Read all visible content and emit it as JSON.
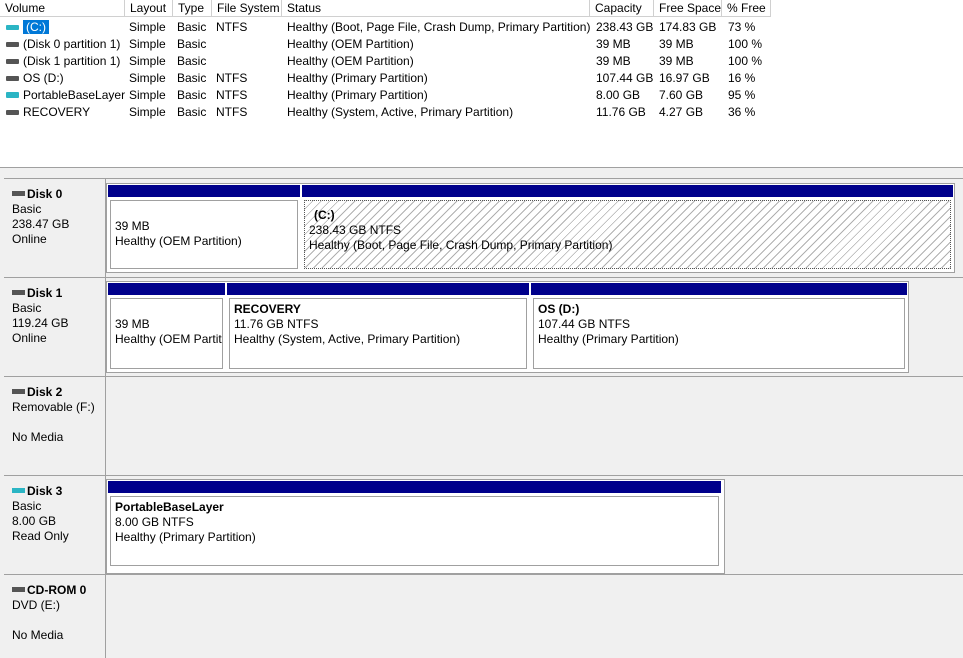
{
  "columns": [
    "Volume",
    "Layout",
    "Type",
    "File System",
    "Status",
    "Capacity",
    "Free Space",
    "% Free"
  ],
  "volumes": [
    {
      "name": "(C:)",
      "layout": "Simple",
      "type": "Basic",
      "fs": "NTFS",
      "status": "Healthy (Boot, Page File, Crash Dump, Primary Partition)",
      "capacity": "238.43 GB",
      "free": "174.83 GB",
      "pct": "73 %"
    },
    {
      "name": "(Disk 0 partition 1)",
      "layout": "Simple",
      "type": "Basic",
      "fs": "",
      "status": "Healthy (OEM Partition)",
      "capacity": "39 MB",
      "free": "39 MB",
      "pct": "100 %"
    },
    {
      "name": "(Disk 1 partition 1)",
      "layout": "Simple",
      "type": "Basic",
      "fs": "",
      "status": "Healthy (OEM Partition)",
      "capacity": "39 MB",
      "free": "39 MB",
      "pct": "100 %"
    },
    {
      "name": "OS (D:)",
      "layout": "Simple",
      "type": "Basic",
      "fs": "NTFS",
      "status": "Healthy (Primary Partition)",
      "capacity": "107.44 GB",
      "free": "16.97 GB",
      "pct": "16 %"
    },
    {
      "name": "PortableBaseLayer",
      "layout": "Simple",
      "type": "Basic",
      "fs": "NTFS",
      "status": "Healthy (Primary Partition)",
      "capacity": "8.00 GB",
      "free": "7.60 GB",
      "pct": "95 %"
    },
    {
      "name": "RECOVERY",
      "layout": "Simple",
      "type": "Basic",
      "fs": "NTFS",
      "status": "Healthy (System, Active, Primary Partition)",
      "capacity": "11.76 GB",
      "free": "4.27 GB",
      "pct": "36 %"
    }
  ],
  "disks": [
    {
      "title": "Disk 0",
      "line1": "Basic",
      "line2": "238.47 GB",
      "line3": "Online",
      "partitions": [
        {
          "name": "",
          "size": "39 MB",
          "status": "Healthy (OEM Partition)"
        },
        {
          "name": "(C:)",
          "size": "238.43 GB NTFS",
          "status": "Healthy (Boot, Page File, Crash Dump, Primary Partition)"
        }
      ]
    },
    {
      "title": "Disk 1",
      "line1": "Basic",
      "line2": "119.24 GB",
      "line3": "Online",
      "partitions": [
        {
          "name": "",
          "size": "39 MB",
          "status": "Healthy (OEM Partit"
        },
        {
          "name": "RECOVERY",
          "size": "11.76 GB NTFS",
          "status": "Healthy (System, Active, Primary Partition)"
        },
        {
          "name": "OS  (D:)",
          "size": "107.44 GB NTFS",
          "status": "Healthy (Primary Partition)"
        }
      ]
    },
    {
      "title": "Disk 2",
      "line1": "Removable (F:)",
      "line2": "",
      "line3": "No Media",
      "partitions": []
    },
    {
      "title": "Disk 3",
      "line1": "Basic",
      "line2": "8.00 GB",
      "line3": "Read Only",
      "partitions": [
        {
          "name": "PortableBaseLayer",
          "size": "8.00 GB NTFS",
          "status": "Healthy (Primary Partition)"
        }
      ]
    },
    {
      "title": "CD-ROM 0",
      "line1": "DVD (E:)",
      "line2": "",
      "line3": "No Media",
      "partitions": []
    }
  ],
  "colors": {
    "partition_bar": "#00008b",
    "selection": "#0078d7",
    "removable_icon": "#2bb5c4"
  }
}
